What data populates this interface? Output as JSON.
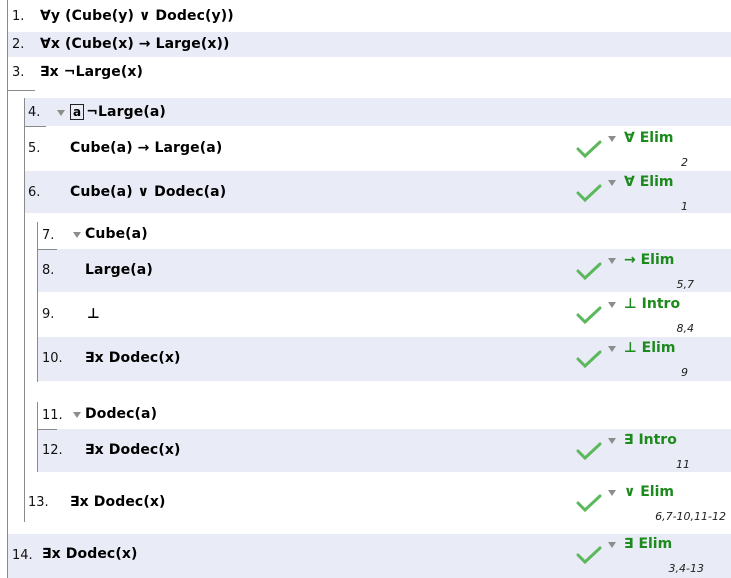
{
  "lines": [
    {
      "num": "1.",
      "formula": "∀y (Cube(y) ∨ Dodec(y))"
    },
    {
      "num": "2.",
      "formula": "∀x (Cube(x) → Large(x))"
    },
    {
      "num": "3.",
      "formula": "∃x ¬Large(x)"
    },
    {
      "num": "4.",
      "box": "a",
      "formula": "¬Large(a)"
    },
    {
      "num": "5.",
      "formula": "Cube(a) → Large(a)",
      "rule": "∀ Elim",
      "cite": "2"
    },
    {
      "num": "6.",
      "formula": "Cube(a) ∨ Dodec(a)",
      "rule": "∀ Elim",
      "cite": "1"
    },
    {
      "num": "7.",
      "formula": "Cube(a)"
    },
    {
      "num": "8.",
      "formula": "Large(a)",
      "rule": "→ Elim",
      "cite": "5,7"
    },
    {
      "num": "9.",
      "formula": "⊥",
      "rule": "⊥ Intro",
      "cite": "8,4"
    },
    {
      "num": "10.",
      "formula": "∃x Dodec(x)",
      "rule": "⊥ Elim",
      "cite": "9"
    },
    {
      "num": "11.",
      "formula": "Dodec(a)"
    },
    {
      "num": "12.",
      "formula": "∃x Dodec(x)",
      "rule": "∃ Intro",
      "cite": "11"
    },
    {
      "num": "13.",
      "formula": "∃x Dodec(x)",
      "rule": "∨ Elim",
      "cite": "6,7-10,11-12"
    },
    {
      "num": "14.",
      "formula": "∃x Dodec(x)",
      "rule": "∃ Elim",
      "cite": "3,4-13"
    }
  ],
  "colors": {
    "band": "#e9ebf6",
    "rule": "#1c8a1c",
    "check": "#5cb85c"
  }
}
